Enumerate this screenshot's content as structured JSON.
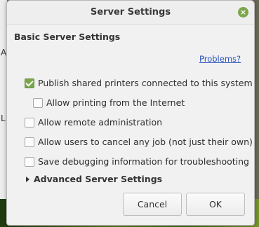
{
  "dialog": {
    "title": "Server Settings",
    "close_icon": "×",
    "section_heading": "Basic Server Settings",
    "problems_link": "Problems?",
    "options": [
      {
        "label": "Publish shared printers connected to this system",
        "checked": true
      },
      {
        "label": "Allow printing from the Internet",
        "checked": false
      },
      {
        "label": "Allow remote administration",
        "checked": false
      },
      {
        "label": "Allow users to cancel any job (not just their own)",
        "checked": false
      },
      {
        "label": "Save debugging information for troubleshooting",
        "checked": false
      }
    ],
    "advanced_expander": "Advanced Server Settings",
    "cancel_label": "Cancel",
    "ok_label": "OK"
  },
  "background_chars": [
    "A",
    "L"
  ],
  "colors": {
    "accent": "#7aa64b",
    "link": "#2a52be"
  }
}
